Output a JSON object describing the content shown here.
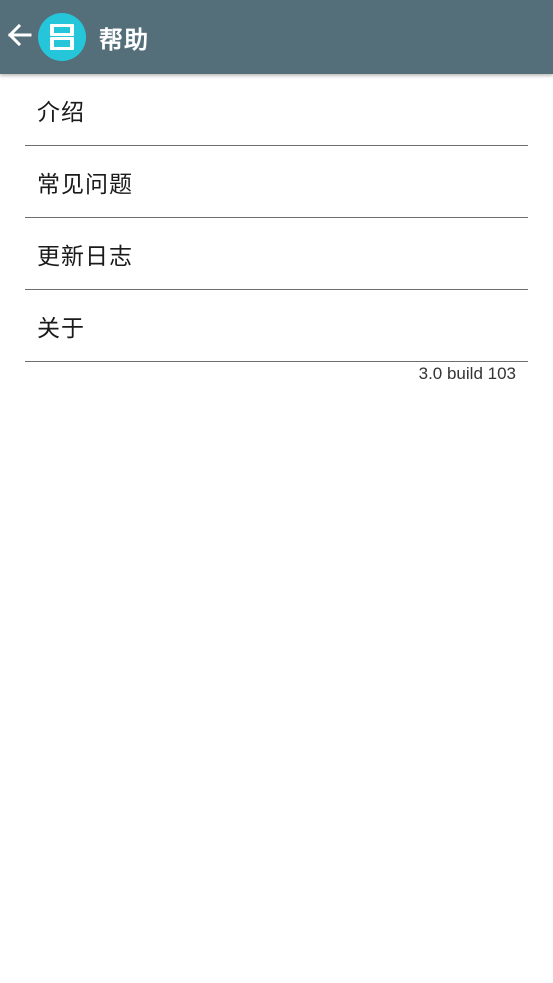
{
  "colors": {
    "appbar_bg": "#546e7a",
    "icon_bg": "#26c6da",
    "divider": "#6e6e6e"
  },
  "appbar": {
    "back_icon": "arrow-back-icon",
    "app_icon": "app-logo-icon",
    "title": "帮助"
  },
  "menu": {
    "items": [
      {
        "label": "介绍"
      },
      {
        "label": "常见问题"
      },
      {
        "label": "更新日志"
      },
      {
        "label": "关于"
      }
    ]
  },
  "footer": {
    "version": "3.0 build 103"
  }
}
